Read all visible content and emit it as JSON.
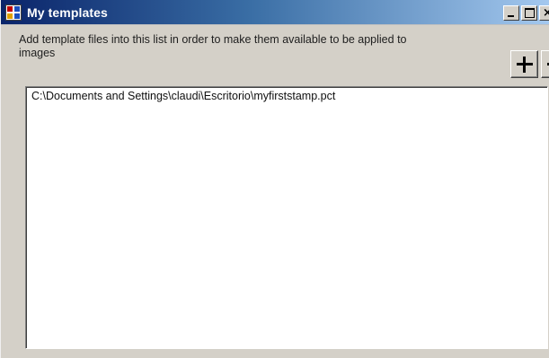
{
  "window": {
    "title": "My templates",
    "controls": {
      "minimize": "minimize",
      "maximize": "maximize",
      "close": "close"
    }
  },
  "description": "Add template files into this list in order to make them available to be applied to images",
  "buttons": {
    "add_icon": "plus-icon",
    "remove_icon": "minus-icon"
  },
  "template_list": {
    "items": [
      "C:\\Documents and Settings\\claudi\\Escritorio\\myfirststamp.pct"
    ]
  },
  "colors": {
    "titlebar_start": "#0a246a",
    "titlebar_end": "#a6caf0",
    "window_bg": "#d4d0c8"
  }
}
